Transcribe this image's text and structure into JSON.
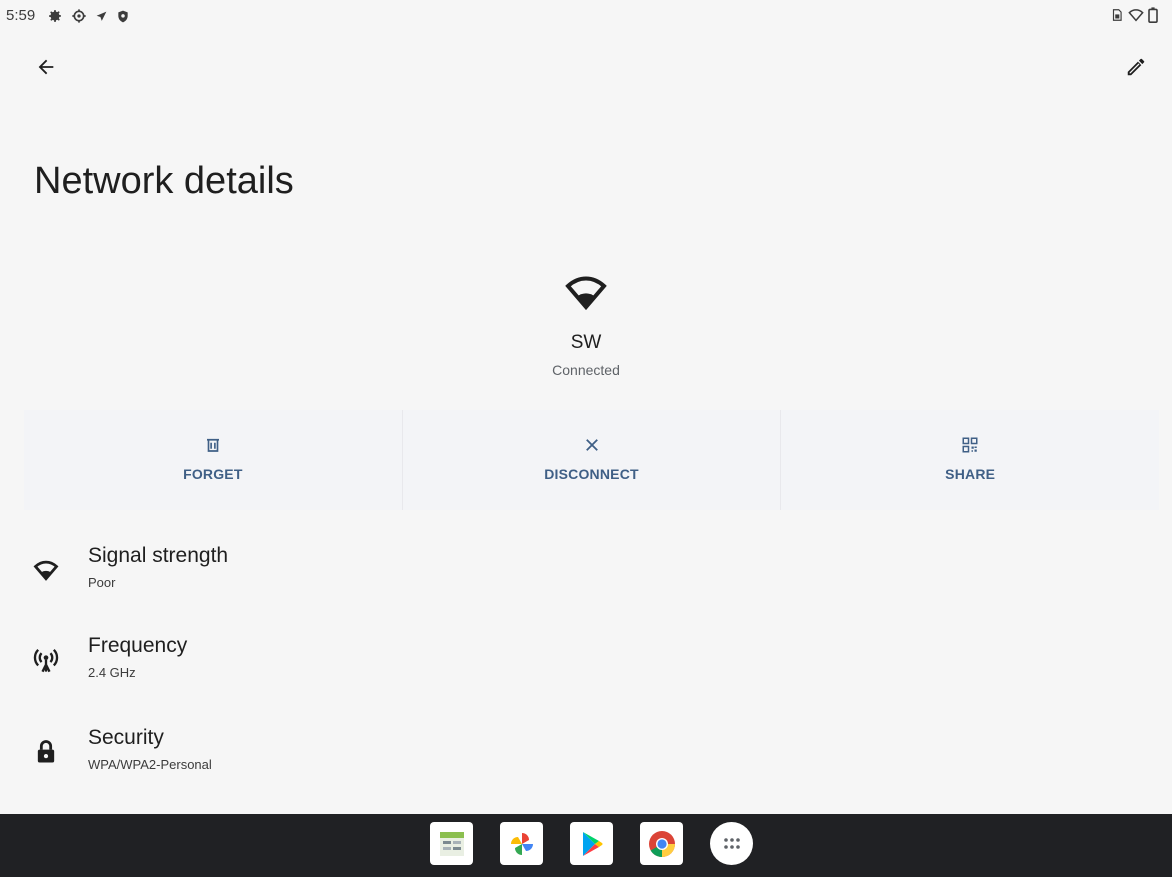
{
  "status_bar": {
    "time": "5:59",
    "left_icons": [
      "settings-gear-icon",
      "settings-cog-icon",
      "location-arrow-icon",
      "shield-icon"
    ],
    "right_icons": [
      "sim-card-icon",
      "wifi-icon",
      "battery-icon"
    ]
  },
  "header": {
    "back_icon": "arrow-back-icon",
    "edit_icon": "pencil-icon",
    "title": "Network details"
  },
  "network": {
    "icon": "wifi-icon",
    "name": "SW",
    "status": "Connected"
  },
  "actions": [
    {
      "label": "FORGET",
      "icon": "trash-icon"
    },
    {
      "label": "DISCONNECT",
      "icon": "close-icon"
    },
    {
      "label": "SHARE",
      "icon": "qr-code-icon"
    }
  ],
  "details": [
    {
      "title": "Signal strength",
      "value": "Poor",
      "icon": "wifi-icon"
    },
    {
      "title": "Frequency",
      "value": "2.4 GHz",
      "icon": "antenna-icon"
    },
    {
      "title": "Security",
      "value": "WPA/WPA2-Personal",
      "icon": "lock-icon"
    }
  ],
  "dock": {
    "apps": [
      "files-app-icon",
      "photos-app-icon",
      "play-store-app-icon",
      "chrome-app-icon",
      "app-drawer-icon"
    ]
  },
  "colors": {
    "background": "#f6f6f6",
    "accent": "#3f5f86",
    "action_row_bg": "#f3f4f7",
    "nav_bar": "#202124"
  }
}
